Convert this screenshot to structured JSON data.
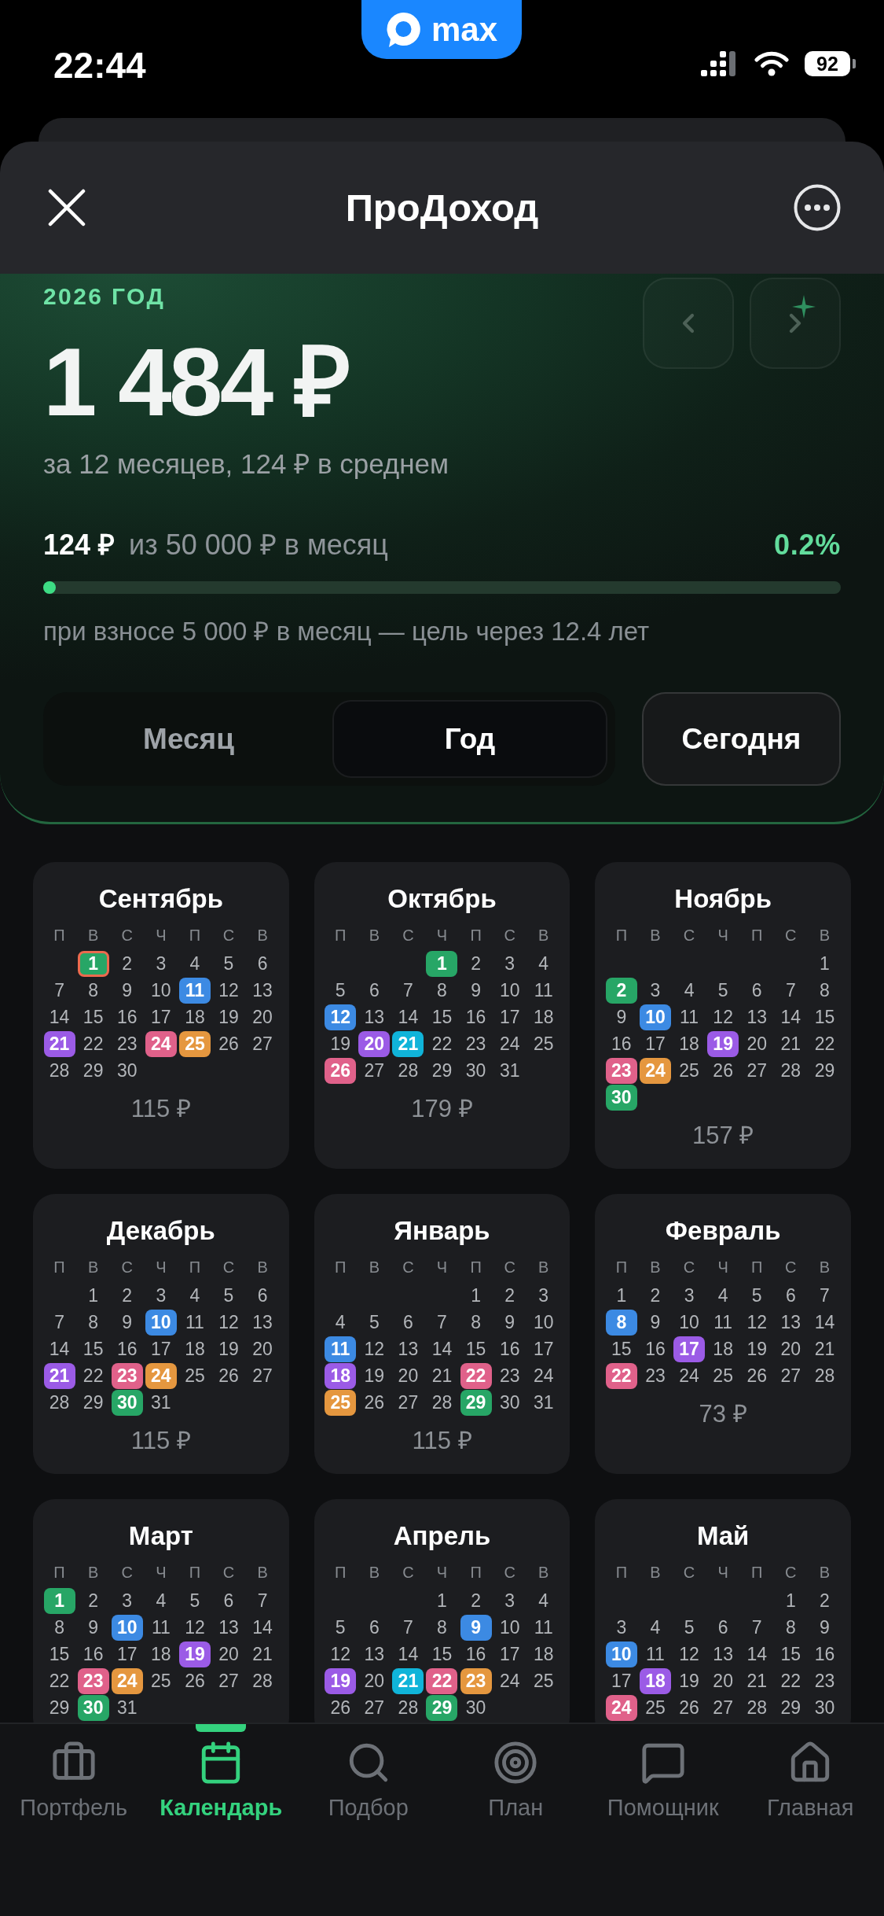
{
  "status_bar": {
    "time": "22:44",
    "app_badge": "max",
    "battery": "92"
  },
  "header": {
    "title": "ПроДоход"
  },
  "summary": {
    "year_label": "2026 ГОД",
    "total": "1 484 ₽",
    "subtitle": "за 12 месяцев, 124 ₽ в среднем",
    "goal": {
      "current": "124 ₽",
      "target": "из 50 000 ₽ в месяц",
      "percent": "0.2%",
      "level": 0.0025,
      "note": "при взносе 5 000 ₽ в месяц — цель через 12.4 лет"
    },
    "period_tabs": [
      {
        "label": "Месяц",
        "selected": false
      },
      {
        "label": "Год",
        "selected": true
      }
    ],
    "today_button": "Сегодня"
  },
  "months": [
    {
      "name": "Сентябрь",
      "weekdays": [
        "П",
        "В",
        "С",
        "Ч",
        "П",
        "С",
        "В"
      ],
      "weeks": [
        [
          {
            "day": "1",
            "color": "#27a666",
            "today": true
          },
          "2",
          "3",
          "4",
          "5",
          "6"
        ],
        [
          "7",
          "8",
          "9",
          "10",
          {
            "day": "11",
            "color": "#3c8ae3",
            "today": false
          },
          "12",
          "13"
        ],
        [
          "14",
          "15",
          "16",
          "17",
          "18",
          "19",
          "20"
        ],
        [
          {
            "day": "21",
            "color": "#9b5be6",
            "today": false
          },
          "22",
          "23",
          {
            "day": "24",
            "color": "#e0618a",
            "today": false
          },
          {
            "day": "25",
            "color": "#e5973f",
            "today": false
          },
          "26",
          "27"
        ],
        [
          "28",
          "29",
          "30"
        ]
      ],
      "total": "115 ₽"
    },
    {
      "name": "Октябрь",
      "weekdays": [
        "П",
        "В",
        "С",
        "Ч",
        "П",
        "С",
        "В"
      ],
      "weeks": [
        [
          {
            "day": "1",
            "color": "#27a666",
            "today": false
          },
          "2",
          "3",
          "4"
        ],
        [
          "5",
          "6",
          "7",
          "8",
          "9",
          "10",
          "11"
        ],
        [
          {
            "day": "12",
            "color": "#3c8ae3",
            "today": false
          },
          "13",
          "14",
          "15",
          "16",
          "17",
          "18"
        ],
        [
          "19",
          {
            "day": "20",
            "color": "#9b5be6",
            "today": false
          },
          {
            "day": "21",
            "color": "#10b4d9",
            "today": false
          },
          "22",
          "23",
          "24",
          "25"
        ],
        [
          {
            "day": "26",
            "color": "#e0618a",
            "today": false
          },
          "27",
          "28",
          "29",
          "30",
          "31"
        ]
      ],
      "total": "179 ₽"
    },
    {
      "name": "Ноябрь",
      "weekdays": [
        "П",
        "В",
        "С",
        "Ч",
        "П",
        "С",
        "В"
      ],
      "weeks": [
        [
          "1"
        ],
        [
          {
            "day": "2",
            "color": "#27a666",
            "today": false
          },
          "3",
          "4",
          "5",
          "6",
          "7",
          "8"
        ],
        [
          "9",
          {
            "day": "10",
            "color": "#3c8ae3",
            "today": false
          },
          "11",
          "12",
          "13",
          "14",
          "15"
        ],
        [
          "16",
          "17",
          "18",
          {
            "day": "19",
            "color": "#9b5be6",
            "today": false
          },
          "20",
          "21",
          "22"
        ],
        [
          {
            "day": "23",
            "color": "#e0618a",
            "today": false
          },
          {
            "day": "24",
            "color": "#e5973f",
            "today": false
          },
          "25",
          "26",
          "27",
          "28",
          "29"
        ],
        [
          {
            "day": "30",
            "color": "#27a666",
            "today": false
          }
        ]
      ],
      "total": "157 ₽"
    },
    {
      "name": "Декабрь",
      "weekdays": [
        "П",
        "В",
        "С",
        "Ч",
        "П",
        "С",
        "В"
      ],
      "weeks": [
        [
          "1",
          "2",
          "3",
          "4",
          "5",
          "6"
        ],
        [
          "7",
          "8",
          "9",
          {
            "day": "10",
            "color": "#3c8ae3",
            "today": false
          },
          "11",
          "12",
          "13"
        ],
        [
          "14",
          "15",
          "16",
          "17",
          "18",
          "19",
          "20"
        ],
        [
          {
            "day": "21",
            "color": "#9b5be6",
            "today": false
          },
          "22",
          {
            "day": "23",
            "color": "#e0618a",
            "today": false
          },
          {
            "day": "24",
            "color": "#e5973f",
            "today": false
          },
          "25",
          "26",
          "27"
        ],
        [
          "28",
          "29",
          {
            "day": "30",
            "color": "#27a666",
            "today": false
          },
          "31"
        ]
      ],
      "total": "115 ₽"
    },
    {
      "name": "Январь",
      "weekdays": [
        "П",
        "В",
        "С",
        "Ч",
        "П",
        "С",
        "В"
      ],
      "weeks": [
        [
          "1",
          "2",
          "3"
        ],
        [
          "4",
          "5",
          "6",
          "7",
          "8",
          "9",
          "10"
        ],
        [
          {
            "day": "11",
            "color": "#3c8ae3",
            "today": false
          },
          "12",
          "13",
          "14",
          "15",
          "16",
          "17"
        ],
        [
          {
            "day": "18",
            "color": "#9b5be6",
            "today": false
          },
          "19",
          "20",
          "21",
          {
            "day": "22",
            "color": "#e0618a",
            "today": false
          },
          "23",
          "24"
        ],
        [
          {
            "day": "25",
            "color": "#e5973f",
            "today": false
          },
          "26",
          "27",
          "28",
          {
            "day": "29",
            "color": "#27a666",
            "today": false
          },
          "30",
          "31"
        ]
      ],
      "total": "115 ₽"
    },
    {
      "name": "Февраль",
      "weekdays": [
        "П",
        "В",
        "С",
        "Ч",
        "П",
        "С",
        "В"
      ],
      "weeks": [
        [
          "1",
          "2",
          "3",
          "4",
          "5",
          "6",
          "7"
        ],
        [
          {
            "day": "8",
            "color": "#3c8ae3",
            "today": false
          },
          "9",
          "10",
          "11",
          "12",
          "13",
          "14"
        ],
        [
          "15",
          "16",
          {
            "day": "17",
            "color": "#9b5be6",
            "today": false
          },
          "18",
          "19",
          "20",
          "21"
        ],
        [
          {
            "day": "22",
            "color": "#e0618a",
            "today": false
          },
          "23",
          "24",
          "25",
          "26",
          "27",
          "28"
        ]
      ],
      "total": "73 ₽"
    },
    {
      "name": "Март",
      "weekdays": [
        "П",
        "В",
        "С",
        "Ч",
        "П",
        "С",
        "В"
      ],
      "weeks": [
        [
          {
            "day": "1",
            "color": "#27a666",
            "today": false
          },
          "2",
          "3",
          "4",
          "5",
          "6",
          "7"
        ],
        [
          "8",
          "9",
          {
            "day": "10",
            "color": "#3c8ae3",
            "today": false
          },
          "11",
          "12",
          "13",
          "14"
        ],
        [
          "15",
          "16",
          "17",
          "18",
          {
            "day": "19",
            "color": "#9b5be6",
            "today": false
          },
          "20",
          "21"
        ],
        [
          "22",
          {
            "day": "23",
            "color": "#e0618a",
            "today": false
          },
          {
            "day": "24",
            "color": "#e5973f",
            "today": false
          },
          "25",
          "26",
          "27",
          "28"
        ],
        [
          "29",
          {
            "day": "30",
            "color": "#27a666",
            "today": false
          },
          "31"
        ]
      ]
    },
    {
      "name": "Апрель",
      "weekdays": [
        "П",
        "В",
        "С",
        "Ч",
        "П",
        "С",
        "В"
      ],
      "weeks": [
        [
          "1",
          "2",
          "3",
          "4"
        ],
        [
          "5",
          "6",
          "7",
          "8",
          {
            "day": "9",
            "color": "#3c8ae3",
            "today": false
          },
          "10",
          "11"
        ],
        [
          "12",
          "13",
          "14",
          "15",
          "16",
          "17",
          "18"
        ],
        [
          {
            "day": "19",
            "color": "#9b5be6",
            "today": false
          },
          "20",
          {
            "day": "21",
            "color": "#10b4d9",
            "today": false
          },
          {
            "day": "22",
            "color": "#e0618a",
            "today": false
          },
          {
            "day": "23",
            "color": "#e5973f",
            "today": false
          },
          "24",
          "25"
        ],
        [
          "26",
          "27",
          "28",
          {
            "day": "29",
            "color": "#27a666",
            "today": false
          },
          "30"
        ]
      ]
    },
    {
      "name": "Май",
      "weekdays": [
        "П",
        "В",
        "С",
        "Ч",
        "П",
        "С",
        "В"
      ],
      "weeks": [
        [
          "1",
          "2"
        ],
        [
          "3",
          "4",
          "5",
          "6",
          "7",
          "8",
          "9"
        ],
        [
          {
            "day": "10",
            "color": "#3c8ae3",
            "today": false
          },
          "11",
          "12",
          "13",
          "14",
          "15",
          "16"
        ],
        [
          "17",
          {
            "day": "18",
            "color": "#9b5be6",
            "today": false
          },
          "19",
          "20",
          "21",
          "22",
          "23"
        ],
        [
          {
            "day": "24",
            "color": "#e0618a",
            "today": false
          },
          "25",
          "26",
          "27",
          "28",
          "29",
          "30"
        ]
      ]
    }
  ],
  "tab_bar": [
    {
      "label": "Портфель",
      "selected": false
    },
    {
      "label": "Календарь",
      "selected": true
    },
    {
      "label": "Подбор",
      "selected": false
    },
    {
      "label": "План",
      "selected": false
    },
    {
      "label": "Помощник",
      "selected": false
    },
    {
      "label": "Главная",
      "selected": false
    }
  ]
}
